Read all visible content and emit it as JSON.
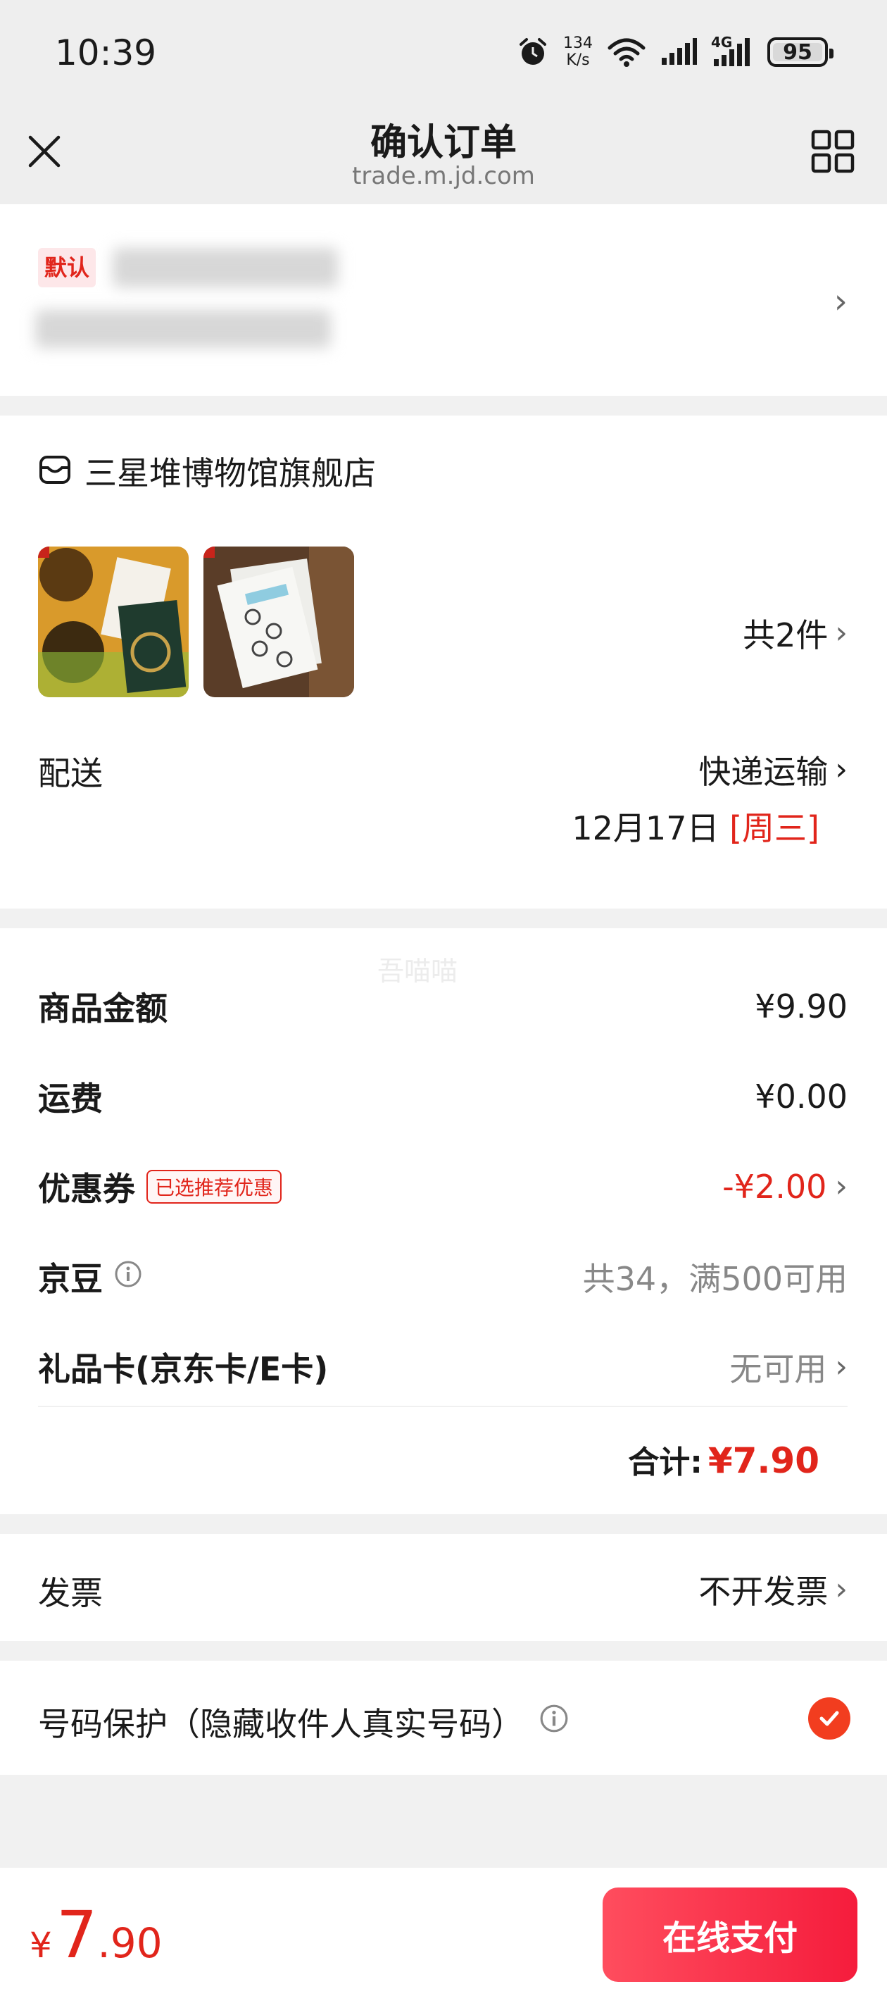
{
  "status_bar": {
    "time": "10:39",
    "net_speed_value": "134",
    "net_speed_unit": "K/s",
    "network_type": "4G",
    "battery": "95"
  },
  "header": {
    "title": "确认订单",
    "domain": "trade.m.jd.com"
  },
  "address": {
    "default_tag": "默认"
  },
  "store": {
    "name": "三星堆博物馆旗舰店"
  },
  "items": {
    "count_label": "共2件"
  },
  "delivery": {
    "label": "配送",
    "method": "快递运输",
    "date": "12月17日",
    "weekday": "[周三]"
  },
  "price_details": {
    "watermark": "吾喵喵",
    "goods_label": "商品金额",
    "goods_value": "¥9.90",
    "shipping_label": "运费",
    "shipping_value": "¥0.00",
    "coupon_label": "优惠券",
    "coupon_tag": "已选推荐优惠",
    "coupon_value": "-¥2.00",
    "jd_beans_label": "京豆",
    "jd_beans_value": "共34，满500可用",
    "giftcard_label": "礼品卡(京东卡/E卡)",
    "giftcard_value": "无可用",
    "total_label": "合计:",
    "total_value": "¥7.90"
  },
  "invoice": {
    "label": "发票",
    "value": "不开发票"
  },
  "privacy": {
    "label": "号码保护（隐藏收件人真实号码）",
    "checked": true
  },
  "footer": {
    "currency": "¥",
    "price_int": "7",
    "price_dec": ".90",
    "pay_button": "在线支付"
  },
  "colors": {
    "accent_red": "#e1251b",
    "pay_button": "#f51c3c",
    "page_bg": "#f1f1f1"
  }
}
